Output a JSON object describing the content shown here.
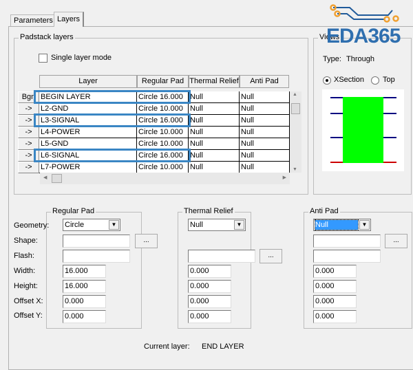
{
  "tabs": [
    "Parameters",
    "Layers"
  ],
  "padstack": {
    "title": "Padstack layers",
    "single_layer_mode": "Single layer mode",
    "columns": [
      "Layer",
      "Regular Pad",
      "Thermal Relief",
      "Anti Pad"
    ],
    "rows": [
      {
        "btn": "Bgn",
        "layer": "BEGIN LAYER",
        "regular": "Circle 16.000",
        "thermal": "Null",
        "anti": "Null"
      },
      {
        "btn": "->",
        "layer": "L2-GND",
        "regular": "Circle 10.000",
        "thermal": "Null",
        "anti": "Null"
      },
      {
        "btn": "->",
        "layer": "L3-SIGNAL",
        "regular": "Circle 16.000",
        "thermal": "Null",
        "anti": "Null"
      },
      {
        "btn": "->",
        "layer": "L4-POWER",
        "regular": "Circle 10.000",
        "thermal": "Null",
        "anti": "Null"
      },
      {
        "btn": "->",
        "layer": "L5-GND",
        "regular": "Circle 10.000",
        "thermal": "Null",
        "anti": "Null"
      },
      {
        "btn": "->",
        "layer": "L6-SIGNAL",
        "regular": "Circle 16.000",
        "thermal": "Null",
        "anti": "Null"
      },
      {
        "btn": "->",
        "layer": "L7-POWER",
        "regular": "Circle 10.000",
        "thermal": "Null",
        "anti": "Null"
      }
    ]
  },
  "views": {
    "title": "Views",
    "type_label": "Type:",
    "type_value": "Through",
    "xsection": "XSection",
    "top": "Top"
  },
  "logo": "EDA365",
  "labels": {
    "geometry": "Geometry:",
    "shape": "Shape:",
    "flash": "Flash:",
    "width": "Width:",
    "height": "Height:",
    "offset_x": "Offset X:",
    "offset_y": "Offset Y:"
  },
  "regular": {
    "title": "Regular Pad",
    "geometry": "Circle",
    "width": "16.000",
    "height": "16.000",
    "offset_x": "0.000",
    "offset_y": "0.000",
    "browse": "..."
  },
  "thermal": {
    "title": "Thermal Relief",
    "geometry": "Null",
    "width": "0.000",
    "height": "0.000",
    "offset_x": "0.000",
    "offset_y": "0.000",
    "browse": "..."
  },
  "anti": {
    "title": "Anti Pad",
    "geometry": "Null",
    "width": "0.000",
    "height": "0.000",
    "offset_x": "0.000",
    "offset_y": "0.000",
    "browse": "..."
  },
  "current_layer": {
    "label": "Current layer:",
    "value": "END LAYER"
  },
  "colors": {
    "highlight": "#3a86c4",
    "via": "#00ff00",
    "layer_line": "#000080",
    "bottom_line": "#cc0000",
    "logo": "#2f6faf"
  }
}
